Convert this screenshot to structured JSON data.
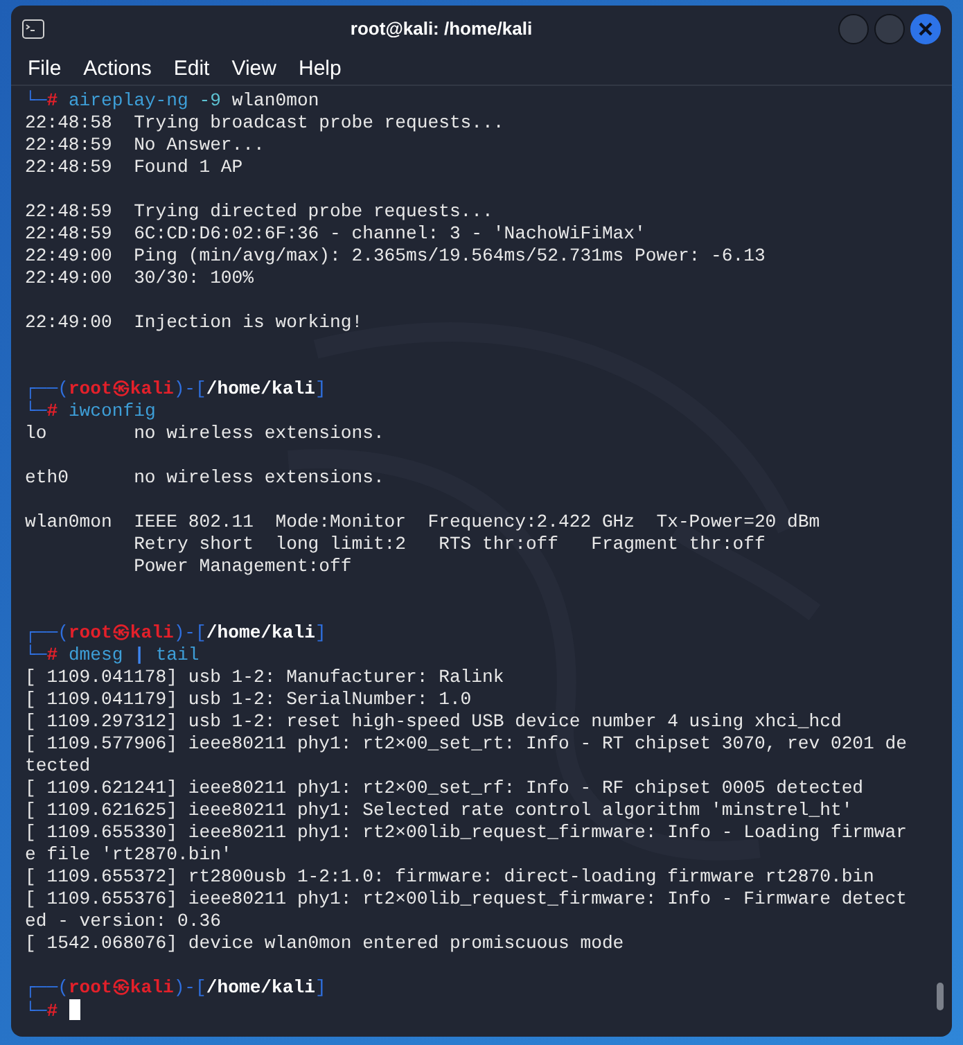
{
  "window": {
    "title": "root@kali: /home/kali"
  },
  "menu": [
    "File",
    "Actions",
    "Edit",
    "View",
    "Help"
  ],
  "lines": [
    {
      "kind": "command",
      "frame": "└─",
      "prompt": "#",
      "tokens": [
        {
          "text": "aireplay-ng",
          "kind": "program"
        },
        {
          "text": "-9",
          "kind": "option"
        },
        {
          "text": "wlan0mon",
          "kind": "argument"
        }
      ]
    },
    {
      "kind": "output",
      "text": "22:48:58  Trying broadcast probe requests..."
    },
    {
      "kind": "output",
      "text": "22:48:59  No Answer..."
    },
    {
      "kind": "output",
      "text": "22:48:59  Found 1 AP"
    },
    {
      "kind": "blank"
    },
    {
      "kind": "output",
      "text": "22:48:59  Trying directed probe requests..."
    },
    {
      "kind": "output",
      "text": "22:48:59  6C:CD:D6:02:6F:36 - channel: 3 - 'NachoWiFiMax'"
    },
    {
      "kind": "output",
      "text": "22:49:00  Ping (min/avg/max): 2.365ms/19.564ms/52.731ms Power: -6.13"
    },
    {
      "kind": "output",
      "text": "22:49:00  30/30: 100%"
    },
    {
      "kind": "blank"
    },
    {
      "kind": "output",
      "text": "22:49:00  Injection is working!"
    },
    {
      "kind": "blank"
    },
    {
      "kind": "blank"
    },
    {
      "kind": "header",
      "open": "┌──(",
      "user": "root㉿kali",
      "mid": ")-[",
      "path": "/home/kali",
      "close": "]"
    },
    {
      "kind": "command",
      "frame": "└─",
      "prompt": "#",
      "tokens": [
        {
          "text": "iwconfig",
          "kind": "program"
        }
      ]
    },
    {
      "kind": "output",
      "text": "lo        no wireless extensions."
    },
    {
      "kind": "blank"
    },
    {
      "kind": "output",
      "text": "eth0      no wireless extensions."
    },
    {
      "kind": "blank"
    },
    {
      "kind": "output",
      "text": "wlan0mon  IEEE 802.11  Mode:Monitor  Frequency:2.422 GHz  Tx-Power=20 dBm"
    },
    {
      "kind": "output",
      "text": "          Retry short  long limit:2   RTS thr:off   Fragment thr:off"
    },
    {
      "kind": "output",
      "text": "          Power Management:off"
    },
    {
      "kind": "blank"
    },
    {
      "kind": "blank"
    },
    {
      "kind": "header",
      "open": "┌──(",
      "user": "root㉿kali",
      "mid": ")-[",
      "path": "/home/kali",
      "close": "]"
    },
    {
      "kind": "command",
      "frame": "└─",
      "prompt": "#",
      "tokens": [
        {
          "text": "dmesg",
          "kind": "program"
        },
        {
          "text": "|",
          "kind": "operator"
        },
        {
          "text": "tail",
          "kind": "program"
        }
      ]
    },
    {
      "kind": "output",
      "text": "[ 1109.041178] usb 1-2: Manufacturer: Ralink"
    },
    {
      "kind": "output",
      "text": "[ 1109.041179] usb 1-2: SerialNumber: 1.0"
    },
    {
      "kind": "output",
      "text": "[ 1109.297312] usb 1-2: reset high-speed USB device number 4 using xhci_hcd"
    },
    {
      "kind": "output",
      "text": "[ 1109.577906] ieee80211 phy1: rt2×00_set_rt: Info - RT chipset 3070, rev 0201 de"
    },
    {
      "kind": "output",
      "text": "tected"
    },
    {
      "kind": "output",
      "text": "[ 1109.621241] ieee80211 phy1: rt2×00_set_rf: Info - RF chipset 0005 detected"
    },
    {
      "kind": "output",
      "text": "[ 1109.621625] ieee80211 phy1: Selected rate control algorithm 'minstrel_ht'"
    },
    {
      "kind": "output",
      "text": "[ 1109.655330] ieee80211 phy1: rt2×00lib_request_firmware: Info - Loading firmwar"
    },
    {
      "kind": "output",
      "text": "e file 'rt2870.bin'"
    },
    {
      "kind": "output",
      "text": "[ 1109.655372] rt2800usb 1-2:1.0: firmware: direct-loading firmware rt2870.bin"
    },
    {
      "kind": "output",
      "text": "[ 1109.655376] ieee80211 phy1: rt2×00lib_request_firmware: Info - Firmware detect"
    },
    {
      "kind": "output",
      "text": "ed - version: 0.36"
    },
    {
      "kind": "output",
      "text": "[ 1542.068076] device wlan0mon entered promiscuous mode"
    },
    {
      "kind": "blank"
    },
    {
      "kind": "header",
      "open": "┌──(",
      "user": "root㉿kali",
      "mid": ")-[",
      "path": "/home/kali",
      "close": "]"
    },
    {
      "kind": "command",
      "frame": "└─",
      "prompt": "#",
      "cursor": true
    }
  ]
}
